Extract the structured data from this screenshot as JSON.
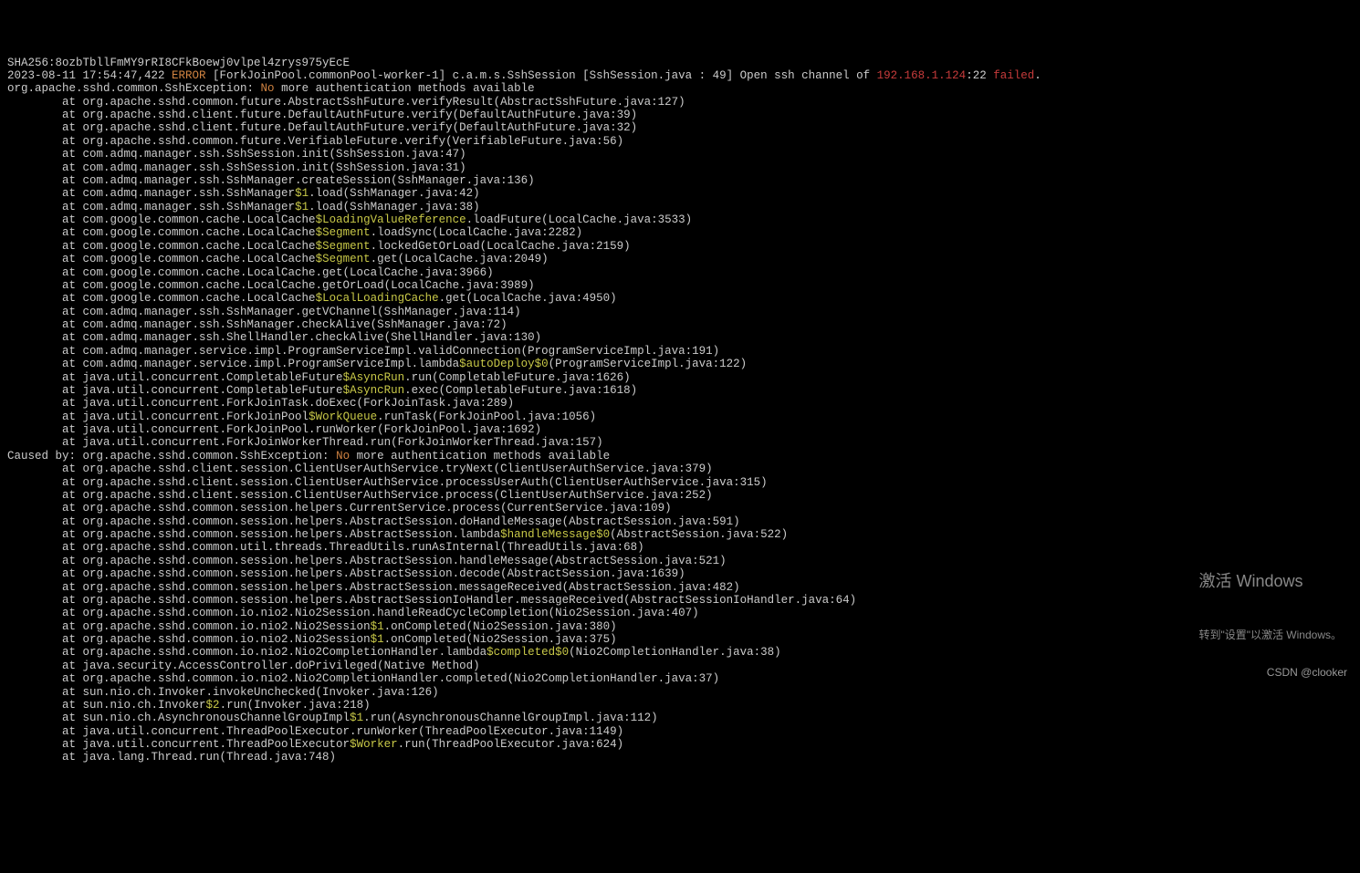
{
  "watermark": {
    "title": "激活 Windows",
    "subtitle": "转到\"设置\"以激活 Windows。"
  },
  "csdn": "CSDN @clooker",
  "lines": [
    {
      "segs": [
        {
          "t": "SHA256:8ozbTbllFmMY9rRI8CFkBoewj0vlpel4zrys975yEcE",
          "c": "white"
        }
      ]
    },
    {
      "segs": [
        {
          "t": "2023-08-11 17:54:47,422 ",
          "c": "white"
        },
        {
          "t": "ERROR",
          "c": "orange"
        },
        {
          "t": " [ForkJoinPool.commonPool-worker-1] c.a.m.s.SshSession [SshSession.java : 49] Open ssh channel of ",
          "c": "white"
        },
        {
          "t": "192.168.1.124",
          "c": "red"
        },
        {
          "t": ":22 ",
          "c": "white"
        },
        {
          "t": "failed",
          "c": "red"
        },
        {
          "t": ".",
          "c": "white"
        }
      ]
    },
    {
      "segs": [
        {
          "t": "org.apache.sshd.common.SshException: ",
          "c": "white"
        },
        {
          "t": "No",
          "c": "orange"
        },
        {
          "t": " more authentication methods available",
          "c": "white"
        }
      ]
    },
    {
      "segs": [
        {
          "t": "        at org.apache.sshd.common.future.AbstractSshFuture.verifyResult(AbstractSshFuture.java:127)",
          "c": "white"
        }
      ]
    },
    {
      "segs": [
        {
          "t": "        at org.apache.sshd.client.future.DefaultAuthFuture.verify(DefaultAuthFuture.java:39)",
          "c": "white"
        }
      ]
    },
    {
      "segs": [
        {
          "t": "        at org.apache.sshd.client.future.DefaultAuthFuture.verify(DefaultAuthFuture.java:32)",
          "c": "white"
        }
      ]
    },
    {
      "segs": [
        {
          "t": "        at org.apache.sshd.common.future.VerifiableFuture.verify(VerifiableFuture.java:56)",
          "c": "white"
        }
      ]
    },
    {
      "segs": [
        {
          "t": "        at com.admq.manager.ssh.SshSession.init(SshSession.java:47)",
          "c": "white"
        }
      ]
    },
    {
      "segs": [
        {
          "t": "        at com.admq.manager.ssh.SshSession.init(SshSession.java:31)",
          "c": "white"
        }
      ]
    },
    {
      "segs": [
        {
          "t": "        at com.admq.manager.ssh.SshManager.createSession(SshManager.java:136)",
          "c": "white"
        }
      ]
    },
    {
      "segs": [
        {
          "t": "        at com.admq.manager.ssh.SshManager",
          "c": "white"
        },
        {
          "t": "$1",
          "c": "yellow"
        },
        {
          "t": ".load(SshManager.java:42)",
          "c": "white"
        }
      ]
    },
    {
      "segs": [
        {
          "t": "        at com.admq.manager.ssh.SshManager",
          "c": "white"
        },
        {
          "t": "$1",
          "c": "yellow"
        },
        {
          "t": ".load(SshManager.java:38)",
          "c": "white"
        }
      ]
    },
    {
      "segs": [
        {
          "t": "        at com.google.common.cache.LocalCache",
          "c": "white"
        },
        {
          "t": "$LoadingValueReference",
          "c": "yellow"
        },
        {
          "t": ".loadFuture(LocalCache.java:3533)",
          "c": "white"
        }
      ]
    },
    {
      "segs": [
        {
          "t": "        at com.google.common.cache.LocalCache",
          "c": "white"
        },
        {
          "t": "$Segment",
          "c": "yellow"
        },
        {
          "t": ".loadSync(LocalCache.java:2282)",
          "c": "white"
        }
      ]
    },
    {
      "segs": [
        {
          "t": "        at com.google.common.cache.LocalCache",
          "c": "white"
        },
        {
          "t": "$Segment",
          "c": "yellow"
        },
        {
          "t": ".lockedGetOrLoad(LocalCache.java:2159)",
          "c": "white"
        }
      ]
    },
    {
      "segs": [
        {
          "t": "        at com.google.common.cache.LocalCache",
          "c": "white"
        },
        {
          "t": "$Segment",
          "c": "yellow"
        },
        {
          "t": ".get(LocalCache.java:2049)",
          "c": "white"
        }
      ]
    },
    {
      "segs": [
        {
          "t": "        at com.google.common.cache.LocalCache.get(LocalCache.java:3966)",
          "c": "white"
        }
      ]
    },
    {
      "segs": [
        {
          "t": "        at com.google.common.cache.LocalCache.getOrLoad(LocalCache.java:3989)",
          "c": "white"
        }
      ]
    },
    {
      "segs": [
        {
          "t": "        at com.google.common.cache.LocalCache",
          "c": "white"
        },
        {
          "t": "$LocalLoadingCache",
          "c": "yellow"
        },
        {
          "t": ".get(LocalCache.java:4950)",
          "c": "white"
        }
      ]
    },
    {
      "segs": [
        {
          "t": "        at com.admq.manager.ssh.SshManager.getVChannel(SshManager.java:114)",
          "c": "white"
        }
      ]
    },
    {
      "segs": [
        {
          "t": "        at com.admq.manager.ssh.SshManager.checkAlive(SshManager.java:72)",
          "c": "white"
        }
      ]
    },
    {
      "segs": [
        {
          "t": "        at com.admq.manager.ssh.ShellHandler.checkAlive(ShellHandler.java:130)",
          "c": "white"
        }
      ]
    },
    {
      "segs": [
        {
          "t": "        at com.admq.manager.service.impl.ProgramServiceImpl.validConnection(ProgramServiceImpl.java:191)",
          "c": "white"
        }
      ]
    },
    {
      "segs": [
        {
          "t": "        at com.admq.manager.service.impl.ProgramServiceImpl.lambda",
          "c": "white"
        },
        {
          "t": "$autoDeploy",
          "c": "yellow"
        },
        {
          "t": "$0",
          "c": "yellow"
        },
        {
          "t": "(ProgramServiceImpl.java:122)",
          "c": "white"
        }
      ]
    },
    {
      "segs": [
        {
          "t": "        at java.util.concurrent.CompletableFuture",
          "c": "white"
        },
        {
          "t": "$AsyncRun",
          "c": "yellow"
        },
        {
          "t": ".run(CompletableFuture.java:1626)",
          "c": "white"
        }
      ]
    },
    {
      "segs": [
        {
          "t": "        at java.util.concurrent.CompletableFuture",
          "c": "white"
        },
        {
          "t": "$AsyncRun",
          "c": "yellow"
        },
        {
          "t": ".exec(CompletableFuture.java:1618)",
          "c": "white"
        }
      ]
    },
    {
      "segs": [
        {
          "t": "        at java.util.concurrent.ForkJoinTask.doExec(ForkJoinTask.java:289)",
          "c": "white"
        }
      ]
    },
    {
      "segs": [
        {
          "t": "        at java.util.concurrent.ForkJoinPool",
          "c": "white"
        },
        {
          "t": "$WorkQueue",
          "c": "yellow"
        },
        {
          "t": ".runTask(ForkJoinPool.java:1056)",
          "c": "white"
        }
      ]
    },
    {
      "segs": [
        {
          "t": "        at java.util.concurrent.ForkJoinPool.runWorker(ForkJoinPool.java:1692)",
          "c": "white"
        }
      ]
    },
    {
      "segs": [
        {
          "t": "        at java.util.concurrent.ForkJoinWorkerThread.run(ForkJoinWorkerThread.java:157)",
          "c": "white"
        }
      ]
    },
    {
      "segs": [
        {
          "t": "Caused by: org.apache.sshd.common.SshException: ",
          "c": "white"
        },
        {
          "t": "No",
          "c": "orange"
        },
        {
          "t": " more authentication methods available",
          "c": "white"
        }
      ]
    },
    {
      "segs": [
        {
          "t": "        at org.apache.sshd.client.session.ClientUserAuthService.tryNext(ClientUserAuthService.java:379)",
          "c": "white"
        }
      ]
    },
    {
      "segs": [
        {
          "t": "        at org.apache.sshd.client.session.ClientUserAuthService.processUserAuth(ClientUserAuthService.java:315)",
          "c": "white"
        }
      ]
    },
    {
      "segs": [
        {
          "t": "        at org.apache.sshd.client.session.ClientUserAuthService.process(ClientUserAuthService.java:252)",
          "c": "white"
        }
      ]
    },
    {
      "segs": [
        {
          "t": "        at org.apache.sshd.common.session.helpers.CurrentService.process(CurrentService.java:109)",
          "c": "white"
        }
      ]
    },
    {
      "segs": [
        {
          "t": "        at org.apache.sshd.common.session.helpers.AbstractSession.doHandleMessage(AbstractSession.java:591)",
          "c": "white"
        }
      ]
    },
    {
      "segs": [
        {
          "t": "        at org.apache.sshd.common.session.helpers.AbstractSession.lambda",
          "c": "white"
        },
        {
          "t": "$handleMessage",
          "c": "yellow"
        },
        {
          "t": "$0",
          "c": "yellow"
        },
        {
          "t": "(AbstractSession.java:522)",
          "c": "white"
        }
      ]
    },
    {
      "segs": [
        {
          "t": "        at org.apache.sshd.common.util.threads.ThreadUtils.runAsInternal(ThreadUtils.java:68)",
          "c": "white"
        }
      ]
    },
    {
      "segs": [
        {
          "t": "        at org.apache.sshd.common.session.helpers.AbstractSession.handleMessage(AbstractSession.java:521)",
          "c": "white"
        }
      ]
    },
    {
      "segs": [
        {
          "t": "        at org.apache.sshd.common.session.helpers.AbstractSession.decode(AbstractSession.java:1639)",
          "c": "white"
        }
      ]
    },
    {
      "segs": [
        {
          "t": "        at org.apache.sshd.common.session.helpers.AbstractSession.messageReceived(AbstractSession.java:482)",
          "c": "white"
        }
      ]
    },
    {
      "segs": [
        {
          "t": "        at org.apache.sshd.common.session.helpers.AbstractSessionIoHandler.messageReceived(AbstractSessionIoHandler.java:64)",
          "c": "white"
        }
      ]
    },
    {
      "segs": [
        {
          "t": "        at org.apache.sshd.common.io.nio2.Nio2Session.handleReadCycleCompletion(Nio2Session.java:407)",
          "c": "white"
        }
      ]
    },
    {
      "segs": [
        {
          "t": "        at org.apache.sshd.common.io.nio2.Nio2Session",
          "c": "white"
        },
        {
          "t": "$1",
          "c": "yellow"
        },
        {
          "t": ".onCompleted(Nio2Session.java:380)",
          "c": "white"
        }
      ]
    },
    {
      "segs": [
        {
          "t": "        at org.apache.sshd.common.io.nio2.Nio2Session",
          "c": "white"
        },
        {
          "t": "$1",
          "c": "yellow"
        },
        {
          "t": ".onCompleted(Nio2Session.java:375)",
          "c": "white"
        }
      ]
    },
    {
      "segs": [
        {
          "t": "        at org.apache.sshd.common.io.nio2.Nio2CompletionHandler.lambda",
          "c": "white"
        },
        {
          "t": "$completed",
          "c": "yellow"
        },
        {
          "t": "$0",
          "c": "yellow"
        },
        {
          "t": "(Nio2CompletionHandler.java:38)",
          "c": "white"
        }
      ]
    },
    {
      "segs": [
        {
          "t": "        at java.security.AccessController.doPrivileged(Native Method)",
          "c": "white"
        }
      ]
    },
    {
      "segs": [
        {
          "t": "        at org.apache.sshd.common.io.nio2.Nio2CompletionHandler.completed(Nio2CompletionHandler.java:37)",
          "c": "white"
        }
      ]
    },
    {
      "segs": [
        {
          "t": "        at sun.nio.ch.Invoker.invokeUnchecked(Invoker.java:126)",
          "c": "white"
        }
      ]
    },
    {
      "segs": [
        {
          "t": "        at sun.nio.ch.Invoker",
          "c": "white"
        },
        {
          "t": "$2",
          "c": "yellow"
        },
        {
          "t": ".run(Invoker.java:218)",
          "c": "white"
        }
      ]
    },
    {
      "segs": [
        {
          "t": "        at sun.nio.ch.AsynchronousChannelGroupImpl",
          "c": "white"
        },
        {
          "t": "$1",
          "c": "yellow"
        },
        {
          "t": ".run(AsynchronousChannelGroupImpl.java:112)",
          "c": "white"
        }
      ]
    },
    {
      "segs": [
        {
          "t": "        at java.util.concurrent.ThreadPoolExecutor.runWorker(ThreadPoolExecutor.java:1149)",
          "c": "white"
        }
      ]
    },
    {
      "segs": [
        {
          "t": "        at java.util.concurrent.ThreadPoolExecutor",
          "c": "white"
        },
        {
          "t": "$Worker",
          "c": "yellow"
        },
        {
          "t": ".run(ThreadPoolExecutor.java:624)",
          "c": "white"
        }
      ]
    },
    {
      "segs": [
        {
          "t": "        at java.lang.Thread.run(Thread.java:748)",
          "c": "white"
        }
      ]
    }
  ]
}
